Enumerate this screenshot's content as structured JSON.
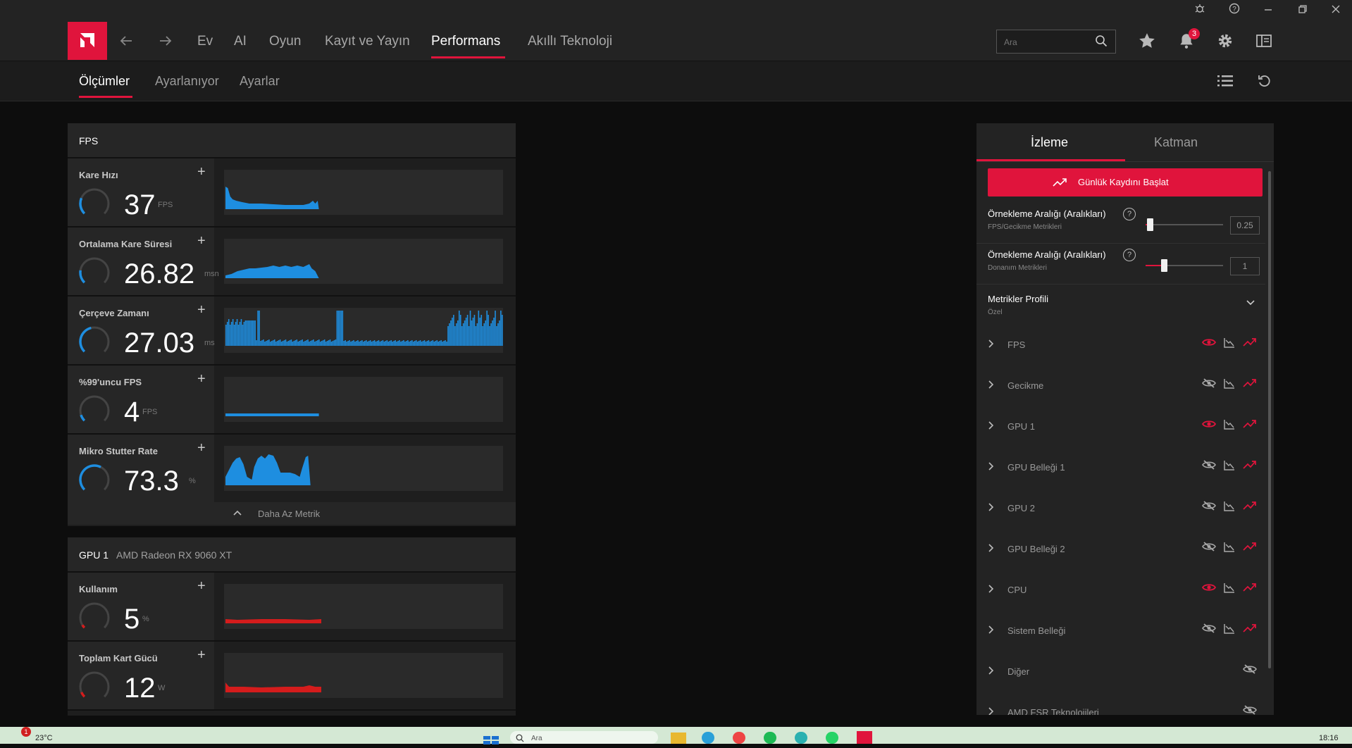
{
  "nav": {
    "items": [
      "Ev",
      "AI",
      "Oyun",
      "Kayıt ve Yayın",
      "Performans",
      "Akıllı Teknoloji"
    ],
    "active": "Performans",
    "search_placeholder": "Ara",
    "notification_count": "3"
  },
  "subnav": {
    "items": [
      "Ölçümler",
      "Ayarlanıyor",
      "Ayarlar"
    ],
    "active": "Ölçümler"
  },
  "fps_panel": {
    "title": "FPS",
    "metrics": [
      {
        "name": "Kare Hızı",
        "value": "37",
        "unit": "FPS",
        "gauge_fraction": 0.25
      },
      {
        "name": "Ortalama Kare Süresi",
        "value": "26.82",
        "unit": "msn",
        "gauge_fraction": 0.2
      },
      {
        "name": "Çerçeve Zamanı",
        "value": "27.03",
        "unit": "ms",
        "gauge_fraction": 0.45
      },
      {
        "name": "%99'uncu FPS",
        "value": "4",
        "unit": "FPS",
        "gauge_fraction": 0.1
      },
      {
        "name": "Mikro Stutter Rate",
        "value": "73.3",
        "unit": "%",
        "gauge_fraction": 0.6
      }
    ],
    "less_label": "Daha Az Metrik"
  },
  "gpu_panel": {
    "title": "GPU 1",
    "subtitle": "AMD Radeon RX 9060 XT",
    "metrics": [
      {
        "name": "Kullanım",
        "value": "5",
        "unit": "%",
        "gauge_fraction": 0.05
      },
      {
        "name": "Toplam Kart Gücü",
        "value": "12",
        "unit": "W",
        "gauge_fraction": 0.08
      }
    ]
  },
  "right_panel": {
    "tabs": [
      "İzleme",
      "Katman"
    ],
    "active_tab": "İzleme",
    "log_button": "Günlük Kaydını Başlat",
    "sampling": [
      {
        "title": "Örnekleme Aralığı (Aralıkları)",
        "sub": "FPS/Gecikme Metrikleri",
        "value": "0.25",
        "fraction": 0.0
      },
      {
        "title": "Örnekleme Aralığı (Aralıkları)",
        "sub": "Donanım Metrikleri",
        "value": "1",
        "fraction": 0.2
      }
    ],
    "profile": {
      "title": "Metrikler Profili",
      "sub": "Özel"
    },
    "list": [
      {
        "label": "FPS",
        "visible": true
      },
      {
        "label": "Gecikme",
        "visible": false
      },
      {
        "label": "GPU 1",
        "visible": true
      },
      {
        "label": "GPU Belleği 1",
        "visible": false
      },
      {
        "label": "GPU 2",
        "visible": false
      },
      {
        "label": "GPU Belleği 2",
        "visible": false
      },
      {
        "label": "CPU",
        "visible": true
      },
      {
        "label": "Sistem Belleği",
        "visible": false
      },
      {
        "label": "Diğer",
        "visible": false
      },
      {
        "label": "AMD FSR Teknolojileri",
        "visible": false
      }
    ]
  },
  "taskbar": {
    "weather": "23°C",
    "weather_badge": "1",
    "search": "Ara",
    "time": "18:16"
  },
  "colors": {
    "accent": "#e0143c",
    "fps_chart": "#1e8ee0",
    "gpu_chart": "#d41c1c"
  }
}
